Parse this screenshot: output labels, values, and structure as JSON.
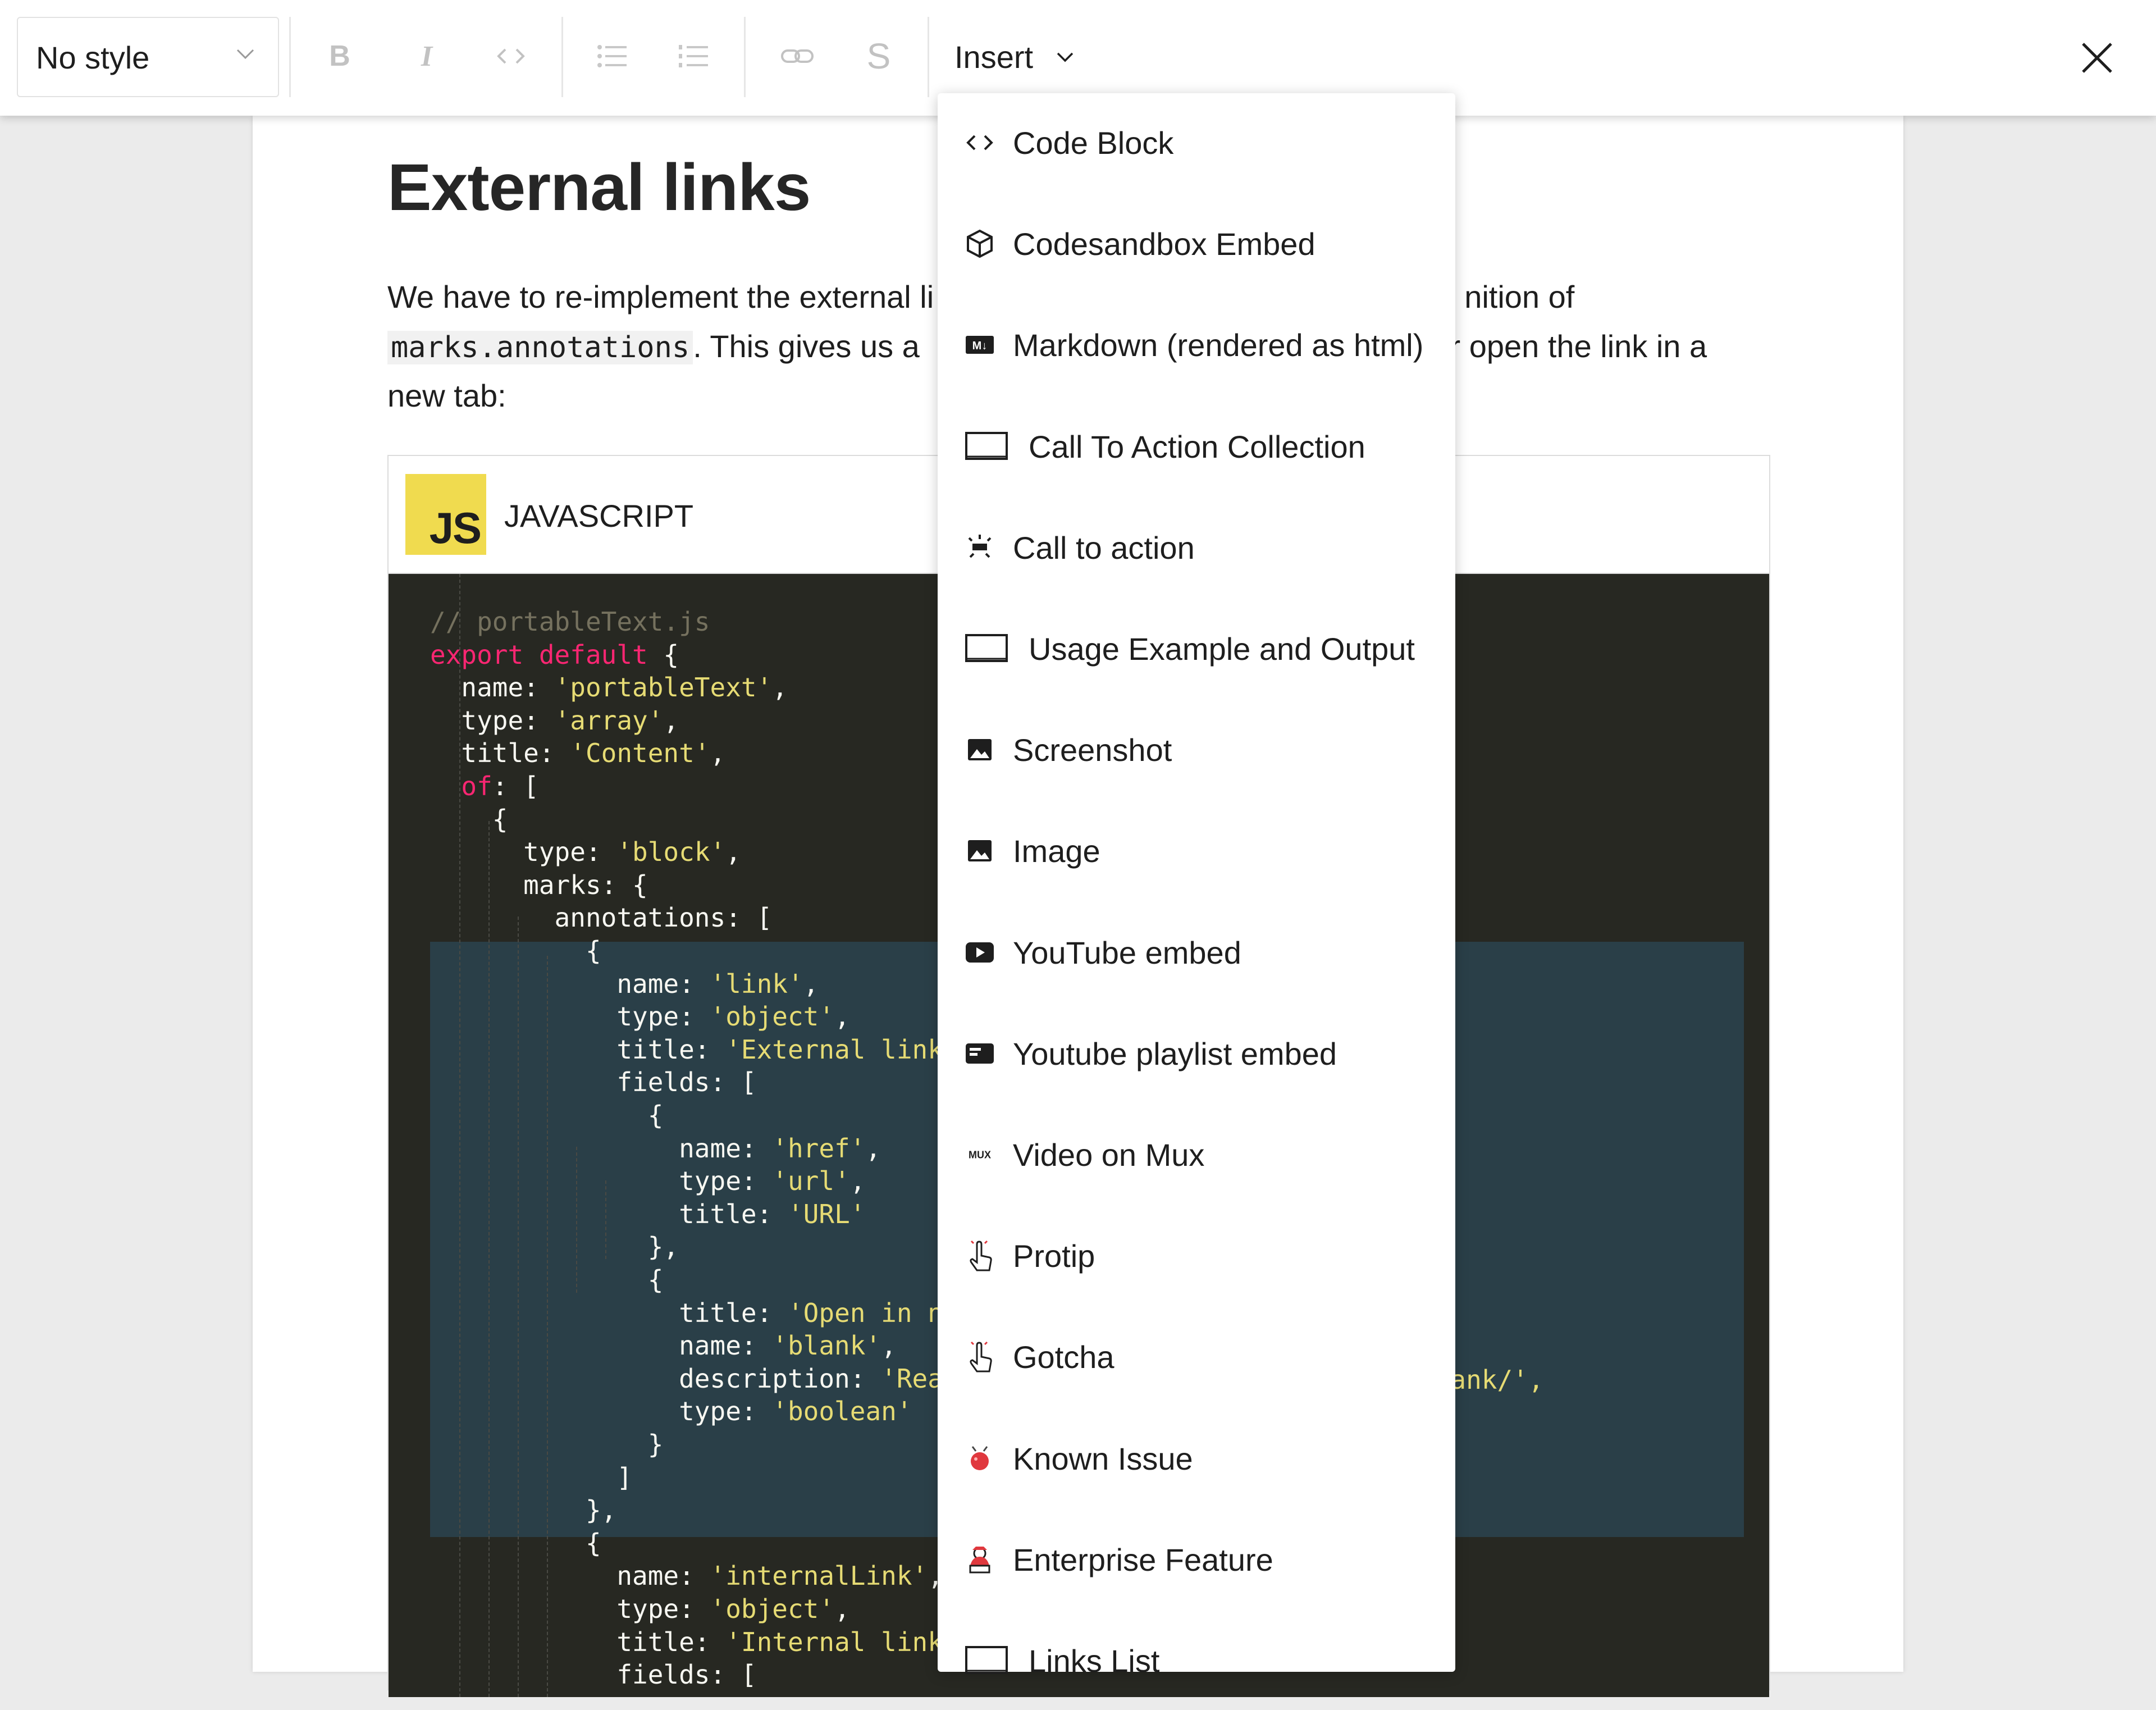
{
  "toolbar": {
    "style_select": "No style",
    "bold": "B",
    "italic": "I",
    "strike": "S",
    "insert_label": "Insert"
  },
  "document": {
    "title": "External links",
    "para_line1_a": "We have to re-implement the external li",
    "para_line1_b": "nition of",
    "para_line2_code": "marks.annotations",
    "para_line2_a": ". This gives us a",
    "para_line2_b": "for open the link in a",
    "para_line3": "new tab:"
  },
  "code_block": {
    "logo_text": "JS",
    "language": "JAVASCRIPT",
    "lines": [
      [
        [
          "cm",
          "// portableText.js"
        ]
      ],
      [
        [
          "kw",
          "export default "
        ],
        [
          "pl",
          "{"
        ]
      ],
      [
        [
          "pl",
          "  name: "
        ],
        [
          "str",
          "'portableText'"
        ],
        [
          "pl",
          ","
        ]
      ],
      [
        [
          "pl",
          "  type: "
        ],
        [
          "str",
          "'array'"
        ],
        [
          "pl",
          ","
        ]
      ],
      [
        [
          "pl",
          "  title: "
        ],
        [
          "str",
          "'Content'"
        ],
        [
          "pl",
          ","
        ]
      ],
      [
        [
          "kw",
          "  of"
        ],
        [
          "pl",
          ": ["
        ]
      ],
      [
        [
          "pl",
          "    {"
        ]
      ],
      [
        [
          "pl",
          "      type: "
        ],
        [
          "str",
          "'block'"
        ],
        [
          "pl",
          ","
        ]
      ],
      [
        [
          "pl",
          "      marks: {"
        ]
      ],
      [
        [
          "pl",
          "        annotations: ["
        ]
      ],
      [
        [
          "pl",
          "          {"
        ]
      ],
      [
        [
          "pl",
          "            name: "
        ],
        [
          "str",
          "'link'"
        ],
        [
          "pl",
          ","
        ]
      ],
      [
        [
          "pl",
          "            type: "
        ],
        [
          "str",
          "'object'"
        ],
        [
          "pl",
          ","
        ]
      ],
      [
        [
          "pl",
          "            title: "
        ],
        [
          "str",
          "'External link'"
        ]
      ],
      [
        [
          "pl",
          "            fields: ["
        ]
      ],
      [
        [
          "pl",
          "              {"
        ]
      ],
      [
        [
          "pl",
          "                name: "
        ],
        [
          "str",
          "'href'"
        ],
        [
          "pl",
          ","
        ]
      ],
      [
        [
          "pl",
          "                type: "
        ],
        [
          "str",
          "'url'"
        ],
        [
          "pl",
          ","
        ]
      ],
      [
        [
          "pl",
          "                title: "
        ],
        [
          "str",
          "'URL'"
        ]
      ],
      [
        [
          "pl",
          "              },"
        ]
      ],
      [
        [
          "pl",
          "              {"
        ]
      ],
      [
        [
          "pl",
          "                title: "
        ],
        [
          "str",
          "'Open in new"
        ]
      ],
      [
        [
          "pl",
          "                name: "
        ],
        [
          "str",
          "'blank'"
        ],
        [
          "pl",
          ","
        ]
      ],
      [
        [
          "pl",
          "                description: "
        ],
        [
          "str",
          "'Read"
        ]
      ],
      [
        [
          "pl",
          "                type: "
        ],
        [
          "str",
          "'boolean'"
        ]
      ],
      [
        [
          "pl",
          "              }"
        ]
      ],
      [
        [
          "pl",
          "            ]"
        ]
      ],
      [
        [
          "pl",
          "          },"
        ]
      ],
      [
        [
          "pl",
          "          {"
        ]
      ],
      [
        [
          "pl",
          "            name: "
        ],
        [
          "str",
          "'internalLink'"
        ],
        [
          "pl",
          ","
        ]
      ],
      [
        [
          "pl",
          "            type: "
        ],
        [
          "str",
          "'object'"
        ],
        [
          "pl",
          ","
        ]
      ],
      [
        [
          "pl",
          "            title: "
        ],
        [
          "str",
          "'Internal link'"
        ]
      ],
      [
        [
          "pl",
          "            fields: ["
        ]
      ]
    ],
    "trailing_fragment": "blank/',"
  },
  "insert_menu": {
    "items": [
      {
        "label": "Code Block",
        "icon": "code-icon"
      },
      {
        "label": "Codesandbox Embed",
        "icon": "cube-icon"
      },
      {
        "label": "Markdown (rendered as html)",
        "icon": "markdown-icon"
      },
      {
        "label": "Call To Action Collection",
        "icon": "block-icon"
      },
      {
        "label": "Call to action",
        "icon": "cta-icon"
      },
      {
        "label": "Usage Example and Output",
        "icon": "block-icon"
      },
      {
        "label": "Screenshot",
        "icon": "image-icon"
      },
      {
        "label": "Image",
        "icon": "image-icon"
      },
      {
        "label": "YouTube embed",
        "icon": "youtube-icon"
      },
      {
        "label": "Youtube playlist embed",
        "icon": "playlist-icon"
      },
      {
        "label": "Video on Mux",
        "icon": "mux-icon"
      },
      {
        "label": "Protip",
        "icon": "hand-pointing-icon"
      },
      {
        "label": "Gotcha",
        "icon": "hand-pointing-icon"
      },
      {
        "label": "Known Issue",
        "icon": "bug-icon"
      },
      {
        "label": "Enterprise Feature",
        "icon": "person-icon"
      },
      {
        "label": "Links List",
        "icon": "block-icon"
      }
    ],
    "mux_icon_text": "MUX",
    "markdown_icon_text": "M↓"
  },
  "colors": {
    "code_bg": "#272822",
    "highlight_bg": "#2a3f48",
    "keyword": "#f92672",
    "string": "#e6db74",
    "comment": "#75715e",
    "js_logo": "#f0db4f"
  }
}
